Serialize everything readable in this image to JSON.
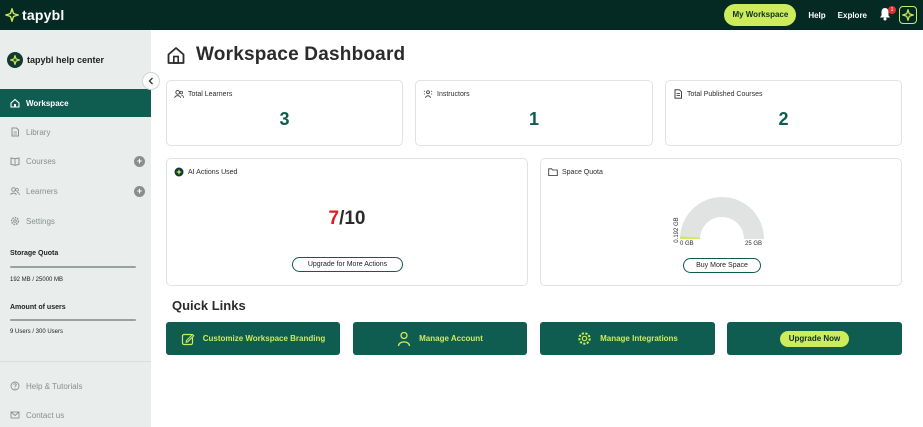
{
  "topbar": {
    "logo_text": "tapybl",
    "my_workspace_label": "My Workspace",
    "help_label": "Help",
    "explore_label": "Explore",
    "notification_count": "1"
  },
  "sidebar": {
    "brand": "tapybl help center",
    "items": [
      {
        "label": "Workspace",
        "icon": "home-icon",
        "active": true
      },
      {
        "label": "Library",
        "icon": "document-icon"
      },
      {
        "label": "Courses",
        "icon": "book-icon"
      },
      {
        "label": "Learners",
        "icon": "users-icon"
      },
      {
        "label": "Settings",
        "icon": "gear-icon"
      }
    ],
    "storage_quota": {
      "label": "Storage Quota",
      "value": "192 MB / 25000 MB",
      "fraction": 0.0077
    },
    "users_quota": {
      "label": "Amount of users",
      "value": "9 Users / 300 Users",
      "fraction": 0.03
    },
    "bottom_items": [
      {
        "label": "Help & Tutorials",
        "icon": "question-icon"
      },
      {
        "label": "Contact us",
        "icon": "mail-icon"
      }
    ]
  },
  "main": {
    "title": "Workspace Dashboard",
    "stats": [
      {
        "label": "Total Learners",
        "value": "3"
      },
      {
        "label": "Instructors",
        "value": "1"
      },
      {
        "label": "Total Published Courses",
        "value": "2"
      }
    ],
    "ai_actions": {
      "label": "AI Actions Used",
      "used": "7",
      "total": "/10",
      "button": "Upgrade for More Actions"
    },
    "space_quota": {
      "label": "Space Quota",
      "used_label": "0.192 GB",
      "min_label": "0 GB",
      "max_label": "25 GB",
      "fraction": 0.0077,
      "button": "Buy More Space"
    },
    "quick_links_title": "Quick Links",
    "quick_links": [
      {
        "label": "Customize Workspace Branding",
        "icon": "edit-icon"
      },
      {
        "label": "Manage Account",
        "icon": "user-icon"
      },
      {
        "label": "Manage Integrations",
        "icon": "gear-icon"
      },
      {
        "label": "Upgrade Now",
        "icon": ""
      }
    ]
  },
  "colors": {
    "brand_dark": "#052a24",
    "brand_green": "#0f5c51",
    "accent_lime": "#cdeb5a",
    "alert_red": "#e01d1d"
  }
}
